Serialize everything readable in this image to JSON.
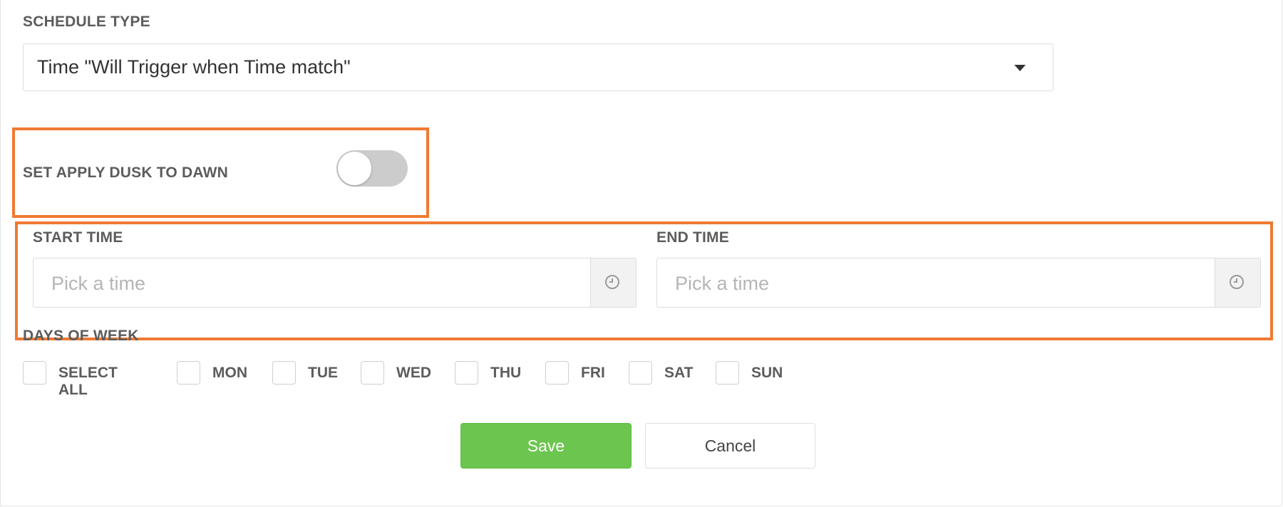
{
  "schedule_type": {
    "label": "SCHEDULE TYPE",
    "selected": "Time \"Will Trigger when Time match\"",
    "caret_icon": "caret-down-icon"
  },
  "dusk_to_dawn": {
    "label": "SET APPLY DUSK TO DAWN",
    "enabled": false
  },
  "start_time": {
    "label": "START TIME",
    "placeholder": "Pick a time",
    "icon": "clock-icon"
  },
  "end_time": {
    "label": "END TIME",
    "placeholder": "Pick a time",
    "icon": "clock-icon"
  },
  "days_of_week": {
    "label": "DAYS OF WEEK",
    "options": [
      {
        "label": "SELECT ALL",
        "checked": false
      },
      {
        "label": "MON",
        "checked": false
      },
      {
        "label": "TUE",
        "checked": false
      },
      {
        "label": "WED",
        "checked": false
      },
      {
        "label": "THU",
        "checked": false
      },
      {
        "label": "FRI",
        "checked": false
      },
      {
        "label": "SAT",
        "checked": false
      },
      {
        "label": "SUN",
        "checked": false
      }
    ]
  },
  "actions": {
    "save_label": "Save",
    "cancel_label": "Cancel"
  },
  "colors": {
    "highlight": "#ef7a33",
    "save_button": "#6cc54f",
    "toggle_off": "#cccccc"
  }
}
